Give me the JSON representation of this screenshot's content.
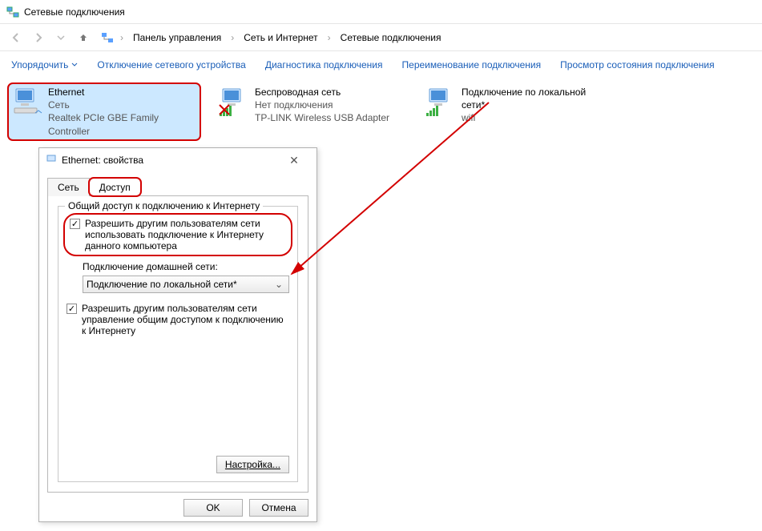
{
  "window": {
    "title": "Сетевые подключения"
  },
  "breadcrumbs": {
    "a": "Панель управления",
    "b": "Сеть и Интернет",
    "c": "Сетевые подключения"
  },
  "toolbar": {
    "organize": "Упорядочить",
    "disable": "Отключение сетевого устройства",
    "diag": "Диагностика подключения",
    "rename": "Переименование подключения",
    "status": "Просмотр состояния подключения"
  },
  "conn": {
    "eth": {
      "title": "Ethernet",
      "sub": "Сеть",
      "sub2": "Realtek PCIe GBE Family Controller"
    },
    "wlan": {
      "title": "Беспроводная сеть",
      "sub": "Нет подключения",
      "sub2": "TP-LINK Wireless USB Adapter"
    },
    "lan": {
      "title": "Подключение по локальной сети*",
      "sub": "wifi"
    }
  },
  "dialog": {
    "title": "Ethernet: свойства",
    "tab_net": "Сеть",
    "tab_access": "Доступ",
    "group_legend": "Общий доступ к подключению к Интернету",
    "chk1": "Разрешить другим пользователям сети использовать подключение к Интернету данного компьютера",
    "home_label": "Подключение домашней сети:",
    "combo_value": "Подключение по локальной сети*",
    "chk2": "Разрешить другим пользователям сети управление общим доступом к подключению к Интернету",
    "settings_btn": "Настройка...",
    "ok": "OK",
    "cancel": "Отмена"
  }
}
